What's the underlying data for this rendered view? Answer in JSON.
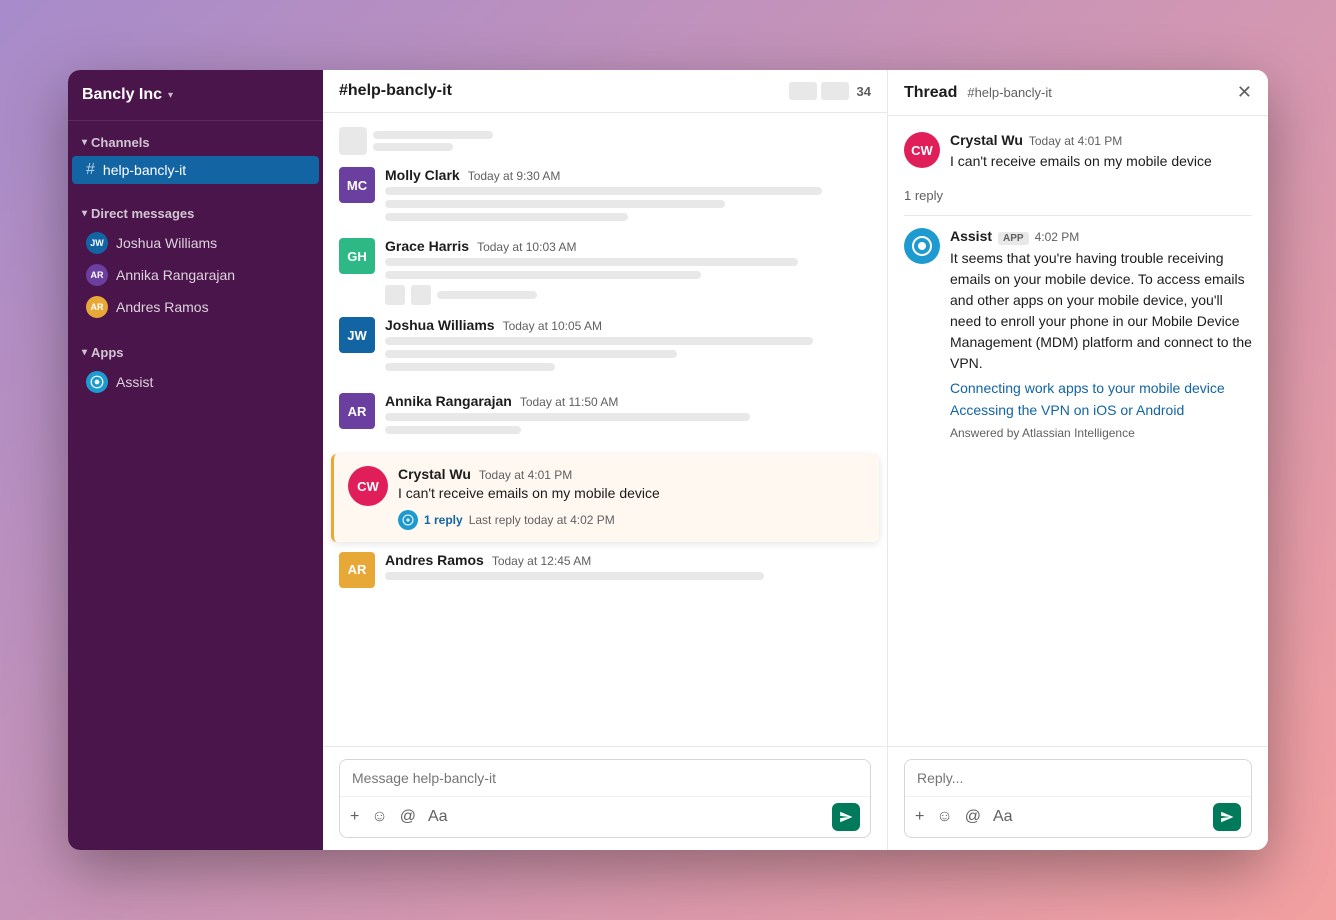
{
  "workspace": {
    "name": "Bancly Inc",
    "chevron": "▾"
  },
  "sidebar": {
    "channels_label": "Channels",
    "active_channel": "#help-bancly-it",
    "channels": [
      {
        "id": "help-bancly-it",
        "name": "help-bancly-it"
      }
    ],
    "dm_label": "Direct messages",
    "dms": [
      {
        "name": "Joshua Williams"
      },
      {
        "name": "Annika Rangarajan"
      },
      {
        "name": "Andres Ramos"
      }
    ],
    "apps_label": "Apps",
    "apps": [
      {
        "name": "Assist"
      }
    ]
  },
  "chat": {
    "channel_name": "#help-bancly-it",
    "member_count": "34",
    "messages": [
      {
        "id": "msg1",
        "author": "Molly Clark",
        "time": "Today at 9:30 AM",
        "lines": [
          3
        ]
      },
      {
        "id": "msg2",
        "author": "Grace Harris",
        "time": "Today at 10:03 AM",
        "lines": [
          2
        ]
      },
      {
        "id": "msg3",
        "author": "Joshua Williams",
        "time": "Today at 10:05 AM",
        "lines": [
          2
        ]
      },
      {
        "id": "msg4",
        "author": "Annika Rangarajan",
        "time": "Today at 11:50 AM",
        "lines": [
          1
        ]
      },
      {
        "id": "msg5",
        "author": "Crystal Wu",
        "time": "Today at 4:01 PM",
        "text": "I can't receive emails on my mobile device",
        "highlighted": true,
        "reply_count": "1 reply",
        "reply_time": "Last reply today at 4:02 PM"
      },
      {
        "id": "msg6",
        "author": "Andres Ramos",
        "time": "Today at 12:45 AM",
        "lines": [
          1
        ]
      }
    ],
    "input_placeholder": "Message help-bancly-it"
  },
  "thread": {
    "title": "Thread",
    "channel": "#help-bancly-it",
    "messages": [
      {
        "author": "Crystal Wu",
        "time": "Today at 4:01 PM",
        "text": "I can't receive emails on my mobile device",
        "is_app": false
      }
    ],
    "reply_count": "1 reply",
    "assist_message": {
      "author": "Assist",
      "time": "4:02 PM",
      "badge": "APP",
      "text": "It seems that you're having trouble receiving emails on your mobile device. To access emails and other apps on your mobile device, you'll need to enroll your phone in our Mobile Device Management (MDM) platform and connect to the VPN.",
      "links": [
        "Connecting work apps to your mobile device",
        "Accessing the VPN on iOS or Android"
      ],
      "answered_by": "Answered by Atlassian Intelligence"
    },
    "reply_placeholder": "Reply..."
  },
  "icons": {
    "plus": "+",
    "emoji": "☺",
    "at": "@",
    "format": "Aa",
    "send": "▶"
  }
}
